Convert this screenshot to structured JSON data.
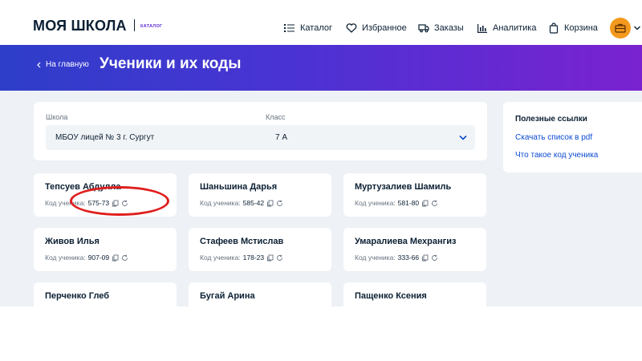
{
  "header": {
    "logo": "МОЯ ШКОЛА",
    "logo_sub": "КАТАЛОГ",
    "nav": [
      {
        "label": "Каталог",
        "icon": "list-icon"
      },
      {
        "label": "Избранное",
        "icon": "heart-icon"
      },
      {
        "label": "Заказы",
        "icon": "truck-icon"
      },
      {
        "label": "Аналитика",
        "icon": "bar-chart-icon"
      },
      {
        "label": "Корзина",
        "icon": "shopping-bag-icon"
      }
    ],
    "avatar_color": "#f39a1d"
  },
  "banner": {
    "back_label": "На главную",
    "title": "Ученики и их коды"
  },
  "filters": {
    "school_label": "Школа",
    "school_value": "МБОУ лицей № 3 г. Сургут",
    "class_label": "Класс",
    "class_value": "7 А"
  },
  "useful_links": {
    "title": "Полезные ссылки",
    "items": [
      "Скачать список в pdf",
      "Что такое код ученика"
    ]
  },
  "students": {
    "code_prefix": "Код ученика:",
    "items": [
      {
        "name": "Тепсуев Абдулла",
        "code": "575-73"
      },
      {
        "name": "Шаньшина Дарья",
        "code": "585-42"
      },
      {
        "name": "Муртузалиев Шамиль",
        "code": "581-80"
      },
      {
        "name": "Живов Илья",
        "code": "907-09"
      },
      {
        "name": "Стафеев Мстислав",
        "code": "178-23"
      },
      {
        "name": "Умаралиева Мехрангиз",
        "code": "333-66"
      },
      {
        "name": "Перченко Глеб",
        "code": ""
      },
      {
        "name": "Бугай Арина",
        "code": ""
      },
      {
        "name": "Пащенко Ксения",
        "code": ""
      }
    ]
  },
  "colors": {
    "banner_start": "#2e3ec9",
    "banner_end": "#7a22d0",
    "link": "#0d4cd3",
    "annotation": "#e01e1e"
  }
}
